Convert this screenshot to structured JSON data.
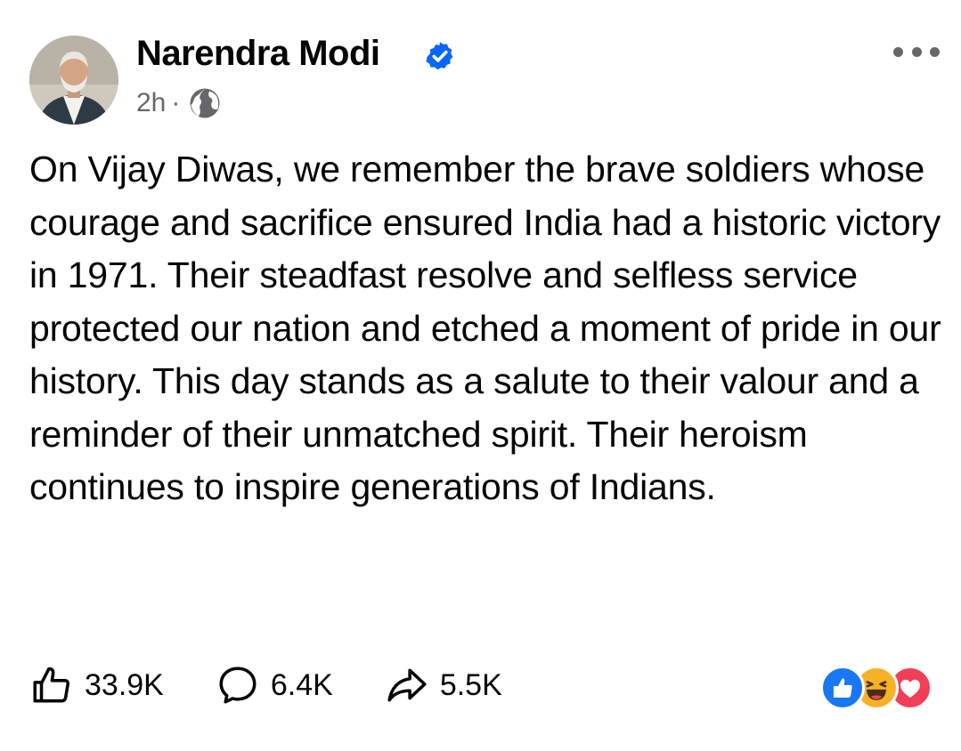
{
  "post": {
    "author": {
      "name": "Narendra Modi",
      "verified": true,
      "avatar_icon": "profile-photo"
    },
    "timestamp": "2h",
    "separator": "·",
    "audience_icon": "globe-icon",
    "more_icon": "more-options-icon",
    "text": "On Vijay Diwas, we remember the brave soldiers whose courage and sacrifice ensured India had a historic victory in 1971. Their steadfast resolve and selfless service protected our nation and etched a moment of pride in our history. This day stands as a salute to their valour and a reminder of their unmatched spirit. Their heroism continues to inspire generations of Indians.",
    "actions": {
      "like": {
        "icon": "thumbs-up-icon",
        "count": "33.9K"
      },
      "comment": {
        "icon": "comment-bubble-icon",
        "count": "6.4K"
      },
      "share": {
        "icon": "share-arrow-icon",
        "count": "5.5K"
      }
    },
    "reactions": [
      "like",
      "haha",
      "love"
    ]
  },
  "colors": {
    "text_primary": "#050505",
    "text_secondary": "#65676b",
    "verified_blue": "#0866ff",
    "like_blue": "#1877f2",
    "haha_yellow": "#f7b125",
    "love_red": "#f33e58"
  }
}
